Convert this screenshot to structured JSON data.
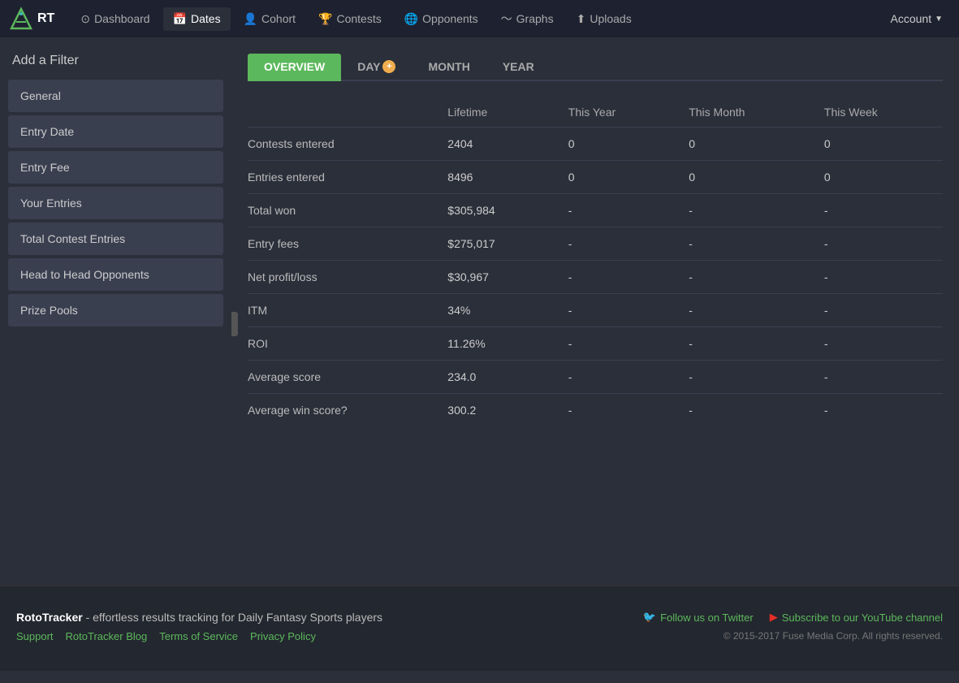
{
  "nav": {
    "logo_text": "RT",
    "links": [
      {
        "id": "dashboard",
        "label": "Dashboard",
        "icon": "⊙",
        "active": false
      },
      {
        "id": "dates",
        "label": "Dates",
        "icon": "📅",
        "active": true
      },
      {
        "id": "cohort",
        "label": "Cohort",
        "icon": "👤",
        "active": false
      },
      {
        "id": "contests",
        "label": "Contests",
        "icon": "🏆",
        "active": false
      },
      {
        "id": "opponents",
        "label": "Opponents",
        "icon": "🌐",
        "active": false
      },
      {
        "id": "graphs",
        "label": "Graphs",
        "icon": "📈",
        "active": false
      },
      {
        "id": "uploads",
        "label": "Uploads",
        "icon": "📤",
        "active": false
      }
    ],
    "account_label": "Account"
  },
  "sidebar": {
    "title": "Add a Filter",
    "filters": [
      {
        "id": "general",
        "label": "General"
      },
      {
        "id": "entry-date",
        "label": "Entry Date"
      },
      {
        "id": "entry-fee",
        "label": "Entry Fee"
      },
      {
        "id": "your-entries",
        "label": "Your Entries"
      },
      {
        "id": "total-contest-entries",
        "label": "Total Contest Entries"
      },
      {
        "id": "head-to-head",
        "label": "Head to Head Opponents"
      },
      {
        "id": "prize-pools",
        "label": "Prize Pools"
      }
    ]
  },
  "tabs": [
    {
      "id": "overview",
      "label": "OVERVIEW",
      "active": true
    },
    {
      "id": "day",
      "label": "DAY",
      "active": false,
      "has_plus": true
    },
    {
      "id": "month",
      "label": "MONTH",
      "active": false
    },
    {
      "id": "year",
      "label": "YEAR",
      "active": false
    }
  ],
  "table": {
    "headers": [
      {
        "id": "metric",
        "label": ""
      },
      {
        "id": "lifetime",
        "label": "Lifetime"
      },
      {
        "id": "this-year",
        "label": "This Year"
      },
      {
        "id": "this-month",
        "label": "This Month"
      },
      {
        "id": "this-week",
        "label": "This Week"
      }
    ],
    "rows": [
      {
        "metric": "Contests entered",
        "lifetime": "2404",
        "this_year": "0",
        "this_month": "0",
        "this_week": "0",
        "highlight": ""
      },
      {
        "metric": "Entries entered",
        "lifetime": "8496",
        "this_year": "0",
        "this_month": "0",
        "this_week": "0",
        "highlight": ""
      },
      {
        "metric": "Total won",
        "lifetime": "$305,984",
        "this_year": "-",
        "this_month": "-",
        "this_week": "-",
        "highlight": ""
      },
      {
        "metric": "Entry fees",
        "lifetime": "$275,017",
        "this_year": "-",
        "this_month": "-",
        "this_week": "-",
        "highlight": ""
      },
      {
        "metric": "Net profit/loss",
        "lifetime": "$30,967",
        "this_year": "-",
        "this_month": "-",
        "this_week": "-",
        "highlight": "green"
      },
      {
        "metric": "ITM",
        "lifetime": "34%",
        "this_year": "-",
        "this_month": "-",
        "this_week": "-",
        "highlight": "teal"
      },
      {
        "metric": "ROI",
        "lifetime": "11.26%",
        "this_year": "-",
        "this_month": "-",
        "this_week": "-",
        "highlight": "green"
      },
      {
        "metric": "Average score",
        "lifetime": "234.0",
        "this_year": "-",
        "this_month": "-",
        "this_week": "-",
        "highlight": ""
      },
      {
        "metric": "Average win score?",
        "lifetime": "300.2",
        "this_year": "-",
        "this_month": "-",
        "this_week": "-",
        "highlight": ""
      }
    ]
  },
  "footer": {
    "brand": "RotoTracker",
    "tagline": " - effortless results tracking for Daily Fantasy Sports players",
    "links": [
      {
        "id": "support",
        "label": "Support"
      },
      {
        "id": "blog",
        "label": "RotoTracker Blog"
      },
      {
        "id": "terms",
        "label": "Terms of Service"
      },
      {
        "id": "privacy",
        "label": "Privacy Policy"
      }
    ],
    "social": [
      {
        "id": "twitter",
        "label": "Follow us on Twitter",
        "icon": "twitter"
      },
      {
        "id": "youtube",
        "label": "Subscribe to our YouTube channel",
        "icon": "youtube"
      }
    ],
    "copyright": "© 2015-2017 Fuse Media Corp. All rights reserved."
  }
}
